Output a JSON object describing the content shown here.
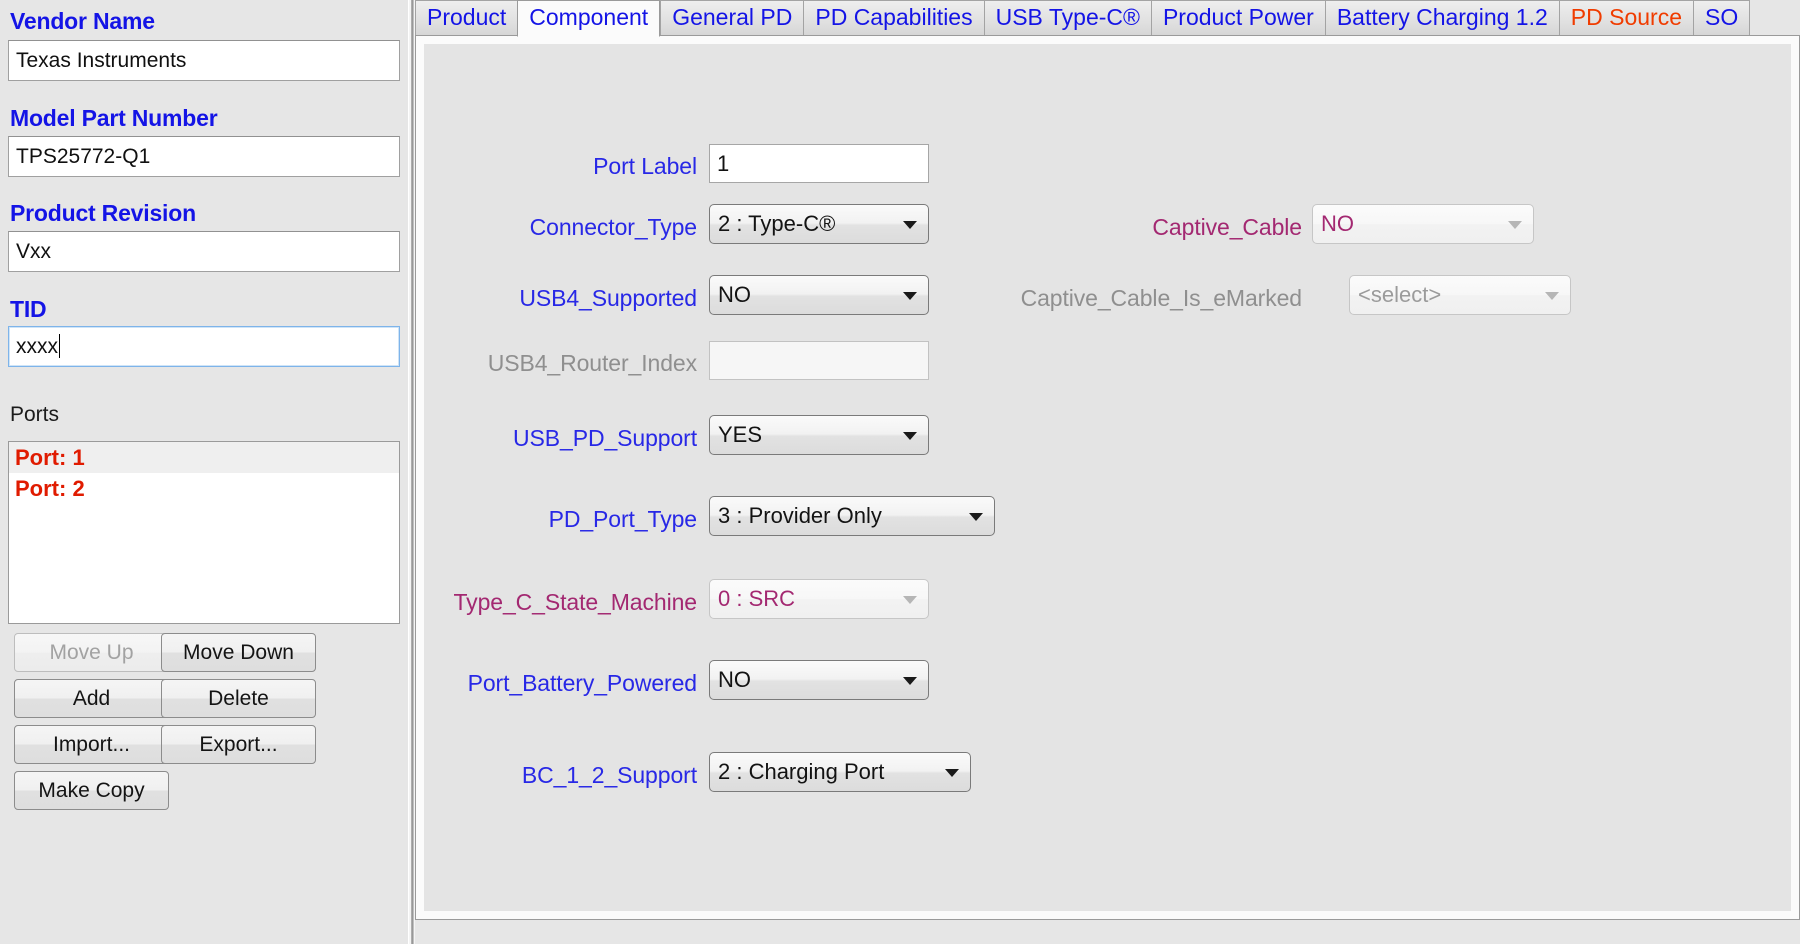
{
  "left_panel": {
    "vendor_name": {
      "label": "Vendor Name",
      "value": "Texas Instruments"
    },
    "model_part_number": {
      "label": "Model Part Number",
      "value": "TPS25772-Q1"
    },
    "product_revision": {
      "label": "Product Revision",
      "value": "Vxx"
    },
    "tid": {
      "label": "TID",
      "value": "xxxx"
    },
    "ports": {
      "label": "Ports",
      "items": [
        {
          "text": "Port: 1",
          "selected": true
        },
        {
          "text": "Port: 2",
          "selected": false
        }
      ]
    },
    "buttons": {
      "move_up": "Move Up",
      "move_down": "Move Down",
      "add": "Add",
      "delete": "Delete",
      "import": "Import...",
      "export": "Export...",
      "make_copy": "Make Copy"
    }
  },
  "tabs": [
    {
      "label": "Product",
      "selected": false,
      "alert": false
    },
    {
      "label": "Component",
      "selected": true,
      "alert": false
    },
    {
      "label": "General PD",
      "selected": false,
      "alert": false
    },
    {
      "label": "PD Capabilities",
      "selected": false,
      "alert": false
    },
    {
      "label": "USB Type-C®",
      "selected": false,
      "alert": false
    },
    {
      "label": "Product Power",
      "selected": false,
      "alert": false
    },
    {
      "label": "Battery Charging 1.2",
      "selected": false,
      "alert": false
    },
    {
      "label": "PD Source",
      "selected": false,
      "alert": true
    },
    {
      "label": "SO",
      "selected": false,
      "alert": false
    }
  ],
  "form": {
    "left_column": [
      {
        "label": "Port Label",
        "kind": "text",
        "value": "1",
        "disabled": false
      },
      {
        "label": "Connector_Type",
        "kind": "combo",
        "value": "2 : Type-C®",
        "disabled": false
      },
      {
        "label": "USB4_Supported",
        "kind": "combo",
        "value": "NO",
        "disabled": false
      },
      {
        "label": "USB4_Router_Index",
        "kind": "text",
        "value": "",
        "disabled": true
      },
      {
        "label": "USB_PD_Support",
        "kind": "combo",
        "value": "YES",
        "disabled": false
      },
      {
        "label": "PD_Port_Type",
        "kind": "combo",
        "value": "3 : Provider Only",
        "disabled": false
      },
      {
        "label": "Type_C_State_Machine",
        "kind": "combo",
        "value": "0 : SRC",
        "disabled": true
      },
      {
        "label": "Port_Battery_Powered",
        "kind": "combo",
        "value": "NO",
        "disabled": false
      },
      {
        "label": "BC_1_2_Support",
        "kind": "combo",
        "value": "2 : Charging Port",
        "disabled": false
      }
    ],
    "right_column": [
      {
        "label": "Captive_Cable",
        "kind": "combo",
        "value": "NO",
        "disabled": true
      },
      {
        "label": "Captive_Cable_Is_eMarked",
        "kind": "combo",
        "value": "<select>",
        "disabled": true
      }
    ]
  },
  "colors": {
    "label_blue": "#2828e6",
    "label_magenta": "#a32871",
    "label_disabled": "#8f8f8f",
    "port_red": "#e01b00",
    "tab_alert": "#f03c00",
    "panel_bg": "#e4e4e4"
  }
}
